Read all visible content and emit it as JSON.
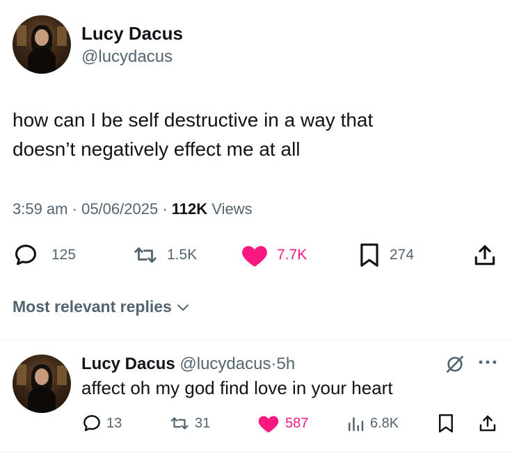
{
  "tweet": {
    "author_name": "Lucy Dacus",
    "author_handle": "@lucydacus",
    "text_line1": "how can I be self destructive in a way that",
    "text_line2": "doesn’t negatively effect me at all",
    "time": "3:59 am",
    "date": "05/06/2025",
    "views_count": "112K",
    "views_label": "Views",
    "replies": "125",
    "reposts": "1.5K",
    "likes": "7.7K",
    "bookmarks": "274"
  },
  "sort": {
    "label": "Most relevant replies"
  },
  "reply": {
    "author_name": "Lucy Dacus",
    "author_handle": "@lucydacus",
    "age": "5h",
    "text": "affect oh my god find love in your heart",
    "replies": "13",
    "reposts": "31",
    "likes": "587",
    "views": "6.8K"
  },
  "colors": {
    "like": "#f91880",
    "muted": "#536471",
    "text": "#0f1419"
  },
  "icons": [
    "reply-icon",
    "repost-icon",
    "heart-icon",
    "bookmark-icon",
    "share-icon",
    "views-icon",
    "grok-icon",
    "more-icon",
    "chevron-down-icon"
  ]
}
